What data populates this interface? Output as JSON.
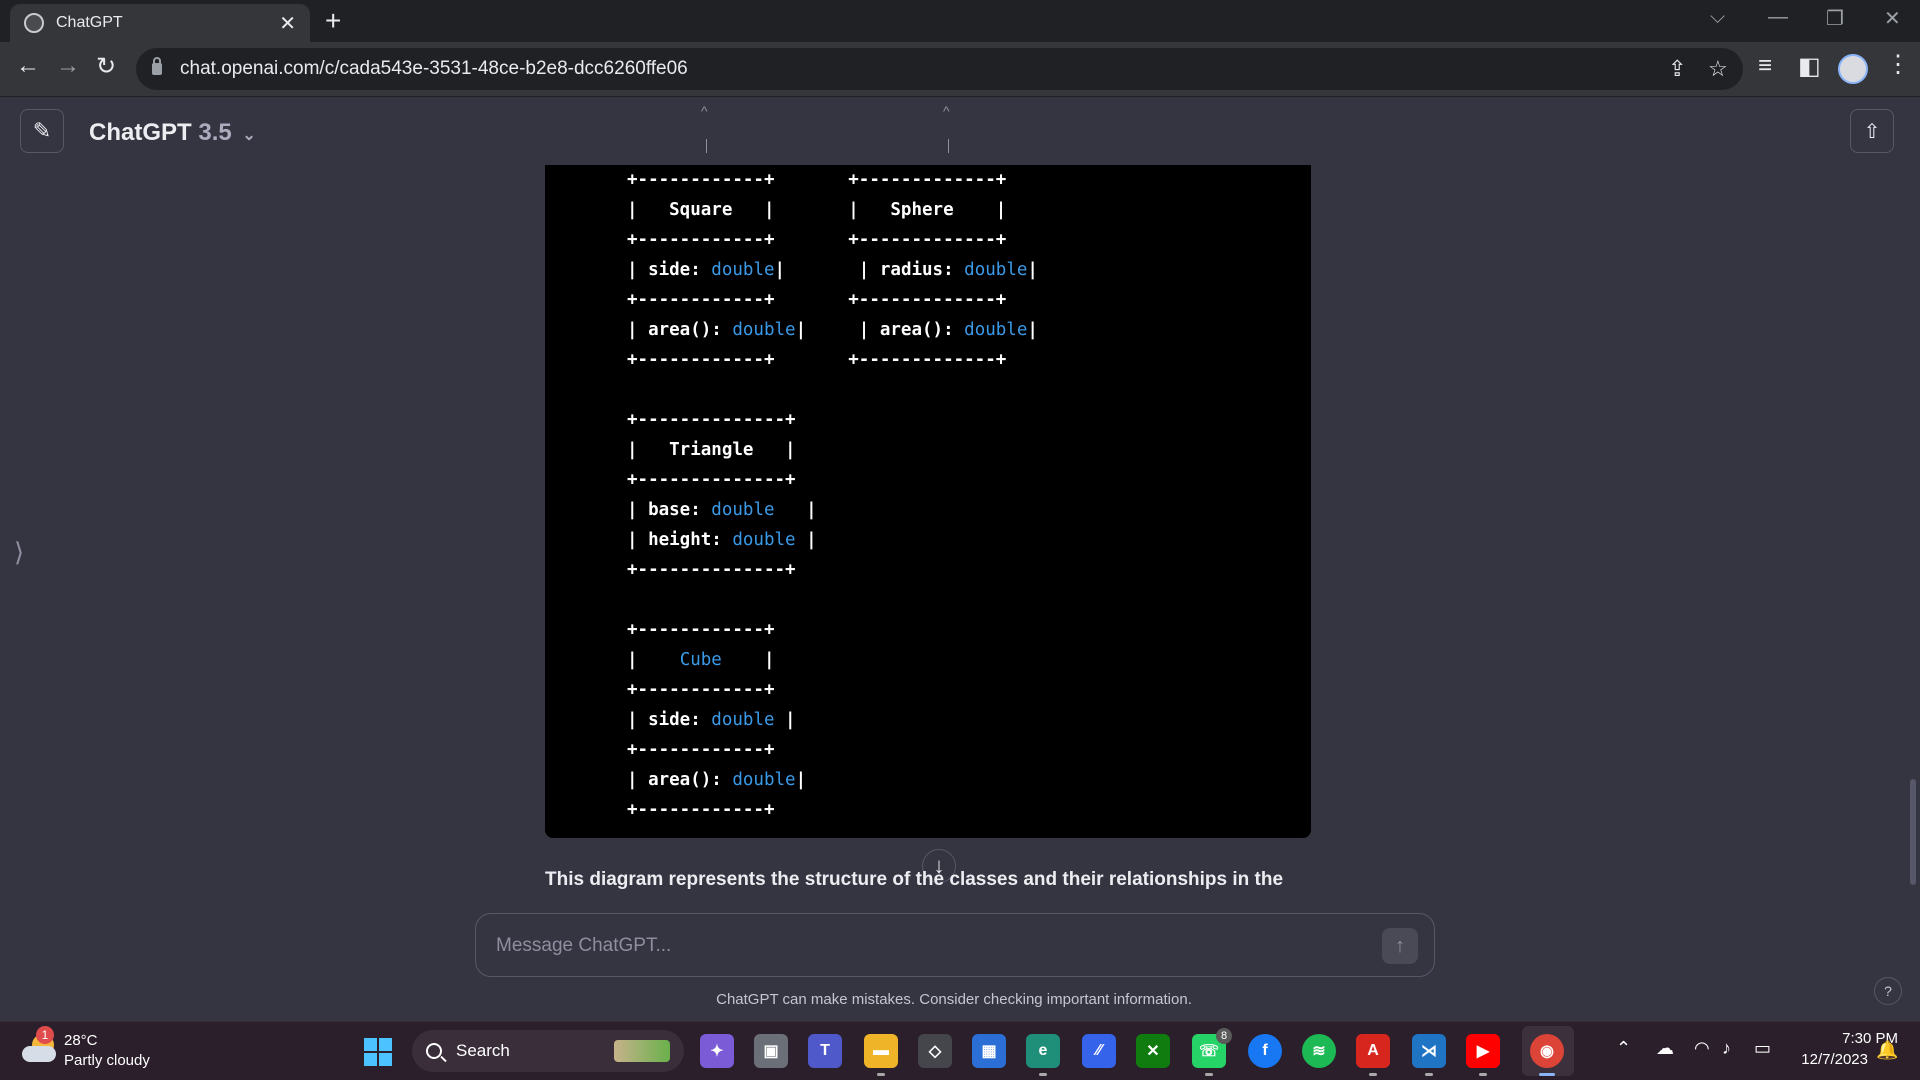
{
  "browser": {
    "tab_title": "ChatGPT",
    "url": "chat.openai.com/c/cada543e-3531-48ce-b2e8-dcc6260ffe06"
  },
  "header": {
    "model_name": "ChatGPT",
    "model_version": "3.5"
  },
  "code_block": {
    "rows": [
      [
        {
          "text": "+------------+       +-------------+"
        }
      ],
      [
        {
          "text": "|   Square   |       |   Sphere    |"
        }
      ],
      [
        {
          "text": "+------------+       +-------------+"
        }
      ],
      [
        {
          "text": "| side: "
        },
        {
          "text": "double",
          "type": true
        },
        {
          "text": "|       | radius: "
        },
        {
          "text": "double",
          "type": true
        },
        {
          "text": "|"
        }
      ],
      [
        {
          "text": "+------------+       +-------------+"
        }
      ],
      [
        {
          "text": "| area(): "
        },
        {
          "text": "double",
          "type": true
        },
        {
          "text": "|     | area(): "
        },
        {
          "text": "double",
          "type": true
        },
        {
          "text": "|"
        }
      ],
      [
        {
          "text": "+------------+       +-------------+"
        }
      ],
      [
        {
          "text": ""
        }
      ],
      [
        {
          "text": "+--------------+"
        }
      ],
      [
        {
          "text": "|   Triangle   |"
        }
      ],
      [
        {
          "text": "+--------------+"
        }
      ],
      [
        {
          "text": "| base: "
        },
        {
          "text": "double",
          "type": true
        },
        {
          "text": "   |"
        }
      ],
      [
        {
          "text": "| height: "
        },
        {
          "text": "double",
          "type": true
        },
        {
          "text": " |"
        }
      ],
      [
        {
          "text": "+--------------+"
        }
      ],
      [
        {
          "text": ""
        }
      ],
      [
        {
          "text": "+------------+"
        }
      ],
      [
        {
          "text": "|    "
        },
        {
          "text": "Cube",
          "type": true
        },
        {
          "text": "    |"
        }
      ],
      [
        {
          "text": "+------------+"
        }
      ],
      [
        {
          "text": "| side: "
        },
        {
          "text": "double",
          "type": true
        },
        {
          "text": " |"
        }
      ],
      [
        {
          "text": "+------------+"
        }
      ],
      [
        {
          "text": "| area(): "
        },
        {
          "text": "double",
          "type": true
        },
        {
          "text": "|"
        }
      ],
      [
        {
          "text": "+------------+"
        }
      ]
    ]
  },
  "summary_text": "This diagram represents the structure of the classes and their relationships in the",
  "composer": {
    "placeholder": "Message ChatGPT..."
  },
  "disclaimer": "ChatGPT can make mistakes. Consider checking important information.",
  "taskbar": {
    "weather_badge": "1",
    "temperature": "28°C",
    "weather": "Partly cloudy",
    "search_label": "Search",
    "whatsapp_badge": "8",
    "time": "7:30 PM",
    "date": "12/7/2023"
  },
  "colors": {
    "page_bg": "#343541",
    "code_bg": "#000000",
    "type_token": "#3b9ae8",
    "taskbar_bg": "#2a1f2a"
  },
  "icons": [
    "chatgpt-logo-icon",
    "close-icon",
    "plus-icon",
    "back-icon",
    "forward-icon",
    "reload-icon",
    "lock-icon",
    "share-page-icon",
    "bookmark-star-icon",
    "reading-list-icon",
    "side-panel-icon",
    "profile-avatar-icon",
    "more-vert-icon",
    "new-chat-icon",
    "chevron-down-icon",
    "share-icon",
    "sidebar-toggle-icon",
    "arrow-down-icon",
    "send-arrow-icon",
    "help-icon",
    "windows-start-icon",
    "search-icon"
  ]
}
